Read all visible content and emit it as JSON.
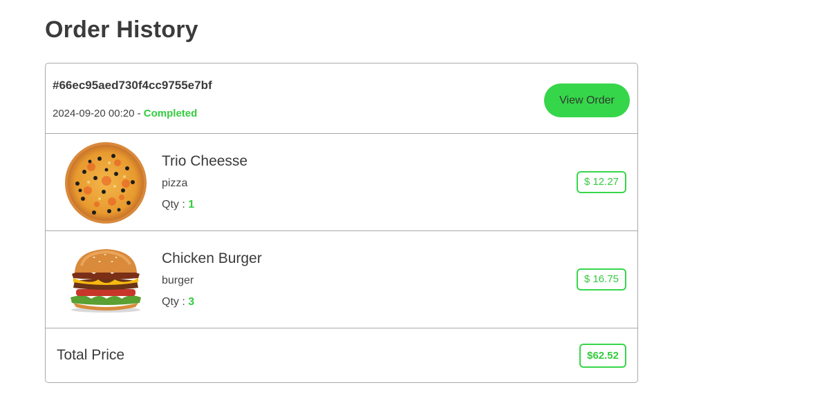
{
  "page": {
    "title": "Order History"
  },
  "order": {
    "id": "#66ec95aed730f4cc9755e7bf",
    "datetime": "2024-09-20 00:20",
    "separator": " - ",
    "status": "Completed",
    "view_label": "View Order",
    "items": [
      {
        "name": "Trio Cheesse",
        "category": "pizza",
        "qty_label": "Qty : ",
        "qty": "1",
        "price": "$ 12.27",
        "image": "pizza-image"
      },
      {
        "name": "Chicken Burger",
        "category": "burger",
        "qty_label": "Qty : ",
        "qty": "3",
        "price": "$ 16.75",
        "image": "burger-image"
      }
    ],
    "total_label": "Total Price",
    "total": "$62.52"
  },
  "colors": {
    "accent": "#36d64a",
    "accent_text": "#33cc3d",
    "border": "#a8a8a8",
    "text": "#3a3a3a"
  }
}
